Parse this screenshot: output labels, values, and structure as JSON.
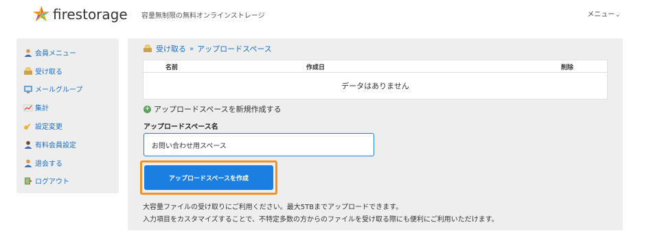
{
  "header": {
    "logo_text": "firestorage",
    "tagline": "容量無制限の無料オンラインストレージ",
    "menu_label": "メニュー",
    "menu_caret": "⌄"
  },
  "sidebar": {
    "items": [
      {
        "label": "会員メニュー",
        "icon": "user-icon"
      },
      {
        "label": "受け取る",
        "icon": "receive-icon"
      },
      {
        "label": "メールグループ",
        "icon": "mail-group-icon"
      },
      {
        "label": "集計",
        "icon": "chart-icon"
      },
      {
        "label": "設定変更",
        "icon": "key-icon"
      },
      {
        "label": "有料会員設定",
        "icon": "premium-user-icon"
      },
      {
        "label": "退会する",
        "icon": "user-leave-icon"
      },
      {
        "label": "ログアウト",
        "icon": "logout-icon"
      }
    ]
  },
  "breadcrumb": {
    "parent": "受け取る",
    "separator": "»",
    "current": "アップロードスペース"
  },
  "table": {
    "columns": [
      "名前",
      "作成日",
      "削除"
    ],
    "empty_message": "データはありません"
  },
  "new_space_link": "アップロードスペースを新規作成する",
  "form": {
    "label": "アップロードスペース名",
    "value": "お問い合わせ用スペース",
    "button_label": "アップロードスペースを作成"
  },
  "description": {
    "line1": "大容量ファイルの受け取りにご利用ください。最大5TBまでアップロードできます。",
    "line2": "入力項目をカスタマイズすることで、不特定多数の方からのファイルを受け取る際にも便利にご利用いただけます。"
  },
  "colors": {
    "link": "#1a6fc4",
    "button": "#1a7fe0",
    "focus_ring": "#f0912a",
    "panel": "#eeeeee"
  }
}
